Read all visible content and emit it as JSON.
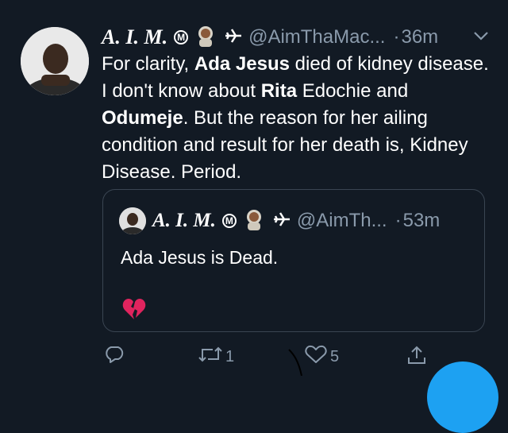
{
  "tweet": {
    "author_name": "A. I. M.",
    "badge_letter": "M",
    "handle": "@AimThaMac...",
    "separator": "·",
    "time": "36m",
    "body": {
      "p1": "For clarity, ",
      "b1": "Ada Jesus",
      "p2": " died of kidney disease. I don't know about ",
      "b2": "Rita",
      "p3": " Edochie and ",
      "b3": "Odumeje",
      "p4": ". But the reason for her ailing condition and result for her death is, Kidney Disease. Period."
    }
  },
  "quoted": {
    "author_name": "A. I. M.",
    "badge_letter": "M",
    "handle": "@AimTh...",
    "separator": "·",
    "time": "53m",
    "text": "Ada Jesus is Dead."
  },
  "actions": {
    "retweet_count": "1",
    "like_count": "5"
  },
  "icons": {
    "reply": "reply-icon",
    "retweet": "retweet-icon",
    "like": "heart-icon",
    "share": "share-icon",
    "broken_heart": "broken-heart-icon"
  },
  "colors": {
    "background": "#121a24",
    "secondary_text": "#8a9aab",
    "accent": "#1da1f2",
    "broken_heart": "#e0245e"
  }
}
